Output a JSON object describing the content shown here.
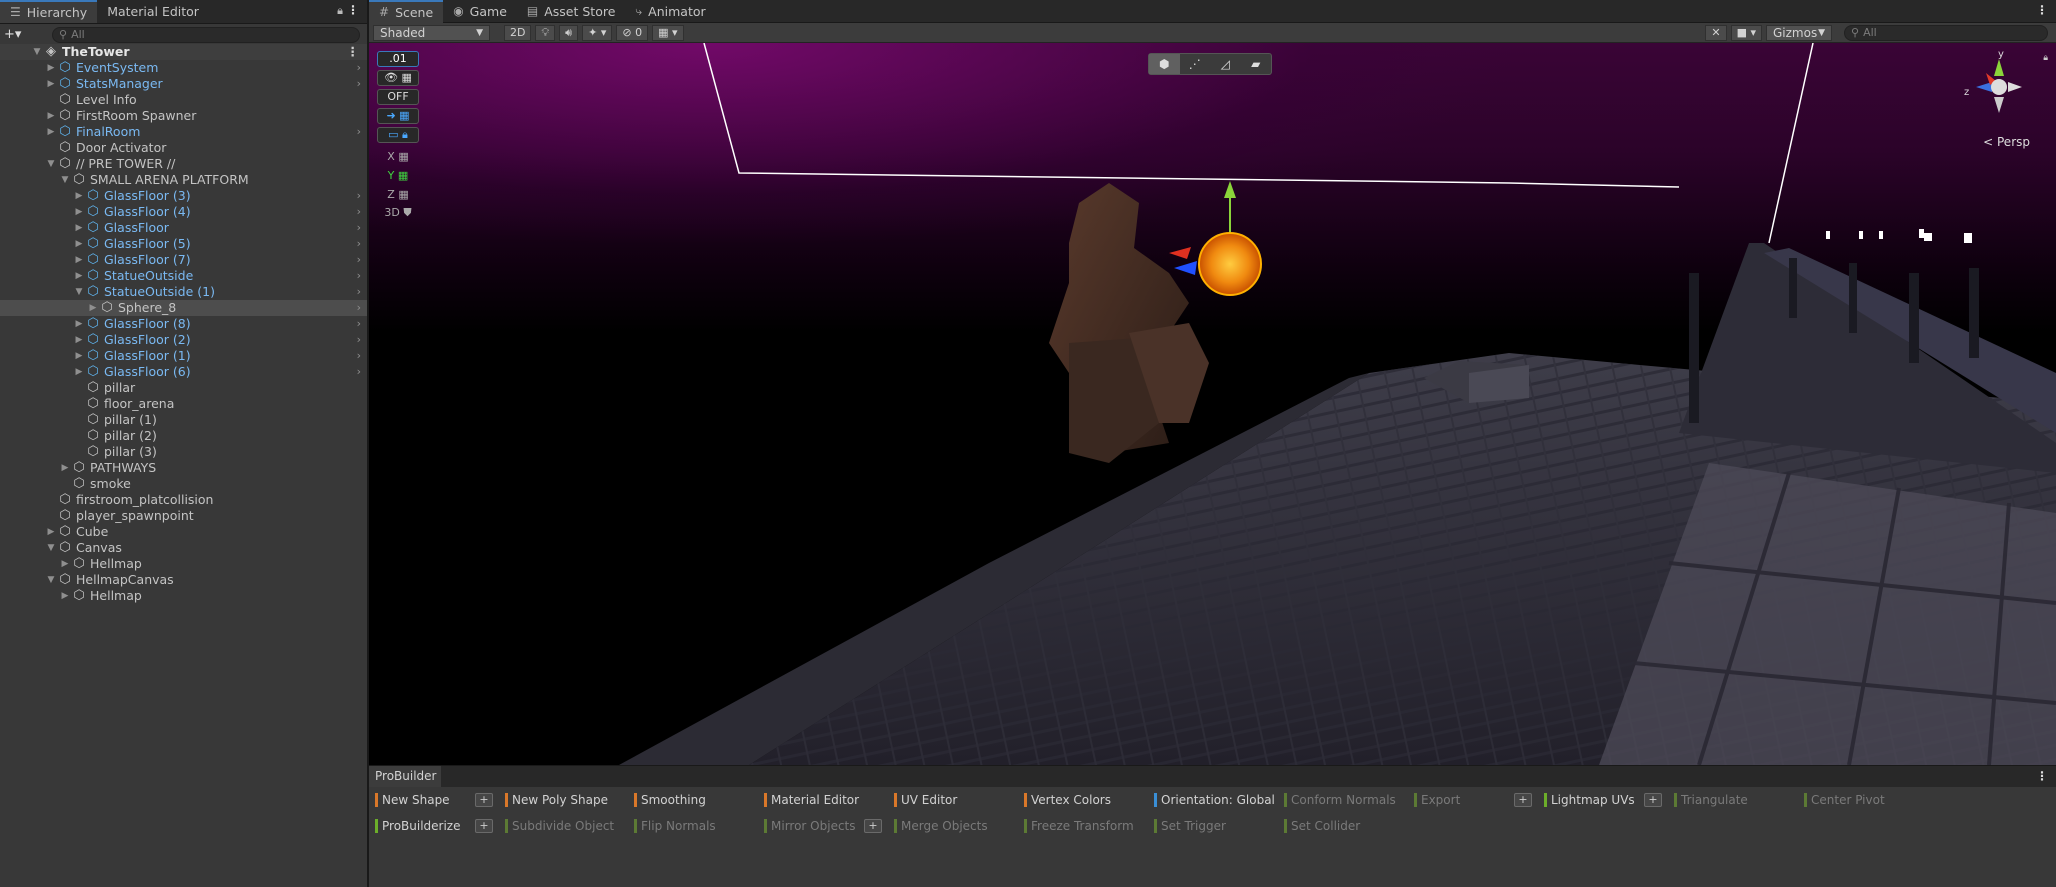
{
  "hierarchy": {
    "tab_hierarchy": "Hierarchy",
    "tab_material": "Material Editor",
    "add_label": "+▾",
    "search_placeholder": "All",
    "rows": [
      {
        "label": "TheTower",
        "depth": 0,
        "arrow": "▼",
        "icon": "scene",
        "kind": "root"
      },
      {
        "label": "EventSystem",
        "depth": 1,
        "arrow": "▶",
        "icon": "prefab",
        "kind": "prefab",
        "chev": true
      },
      {
        "label": "StatsManager",
        "depth": 1,
        "arrow": "▶",
        "icon": "prefab",
        "kind": "prefab",
        "chev": true
      },
      {
        "label": "Level Info",
        "depth": 1,
        "arrow": "",
        "icon": "object",
        "kind": "normal"
      },
      {
        "label": "FirstRoom Spawner",
        "depth": 1,
        "arrow": "▶",
        "icon": "object",
        "kind": "normal"
      },
      {
        "label": "FinalRoom",
        "depth": 1,
        "arrow": "▶",
        "icon": "prefab",
        "kind": "prefab",
        "chev": true
      },
      {
        "label": "Door Activator",
        "depth": 1,
        "arrow": "",
        "icon": "object",
        "kind": "normal"
      },
      {
        "label": "// PRE TOWER //",
        "depth": 1,
        "arrow": "▼",
        "icon": "object",
        "kind": "normal"
      },
      {
        "label": "SMALL ARENA PLATFORM",
        "depth": 2,
        "arrow": "▼",
        "icon": "object",
        "kind": "normal"
      },
      {
        "label": "GlassFloor (3)",
        "depth": 3,
        "arrow": "▶",
        "icon": "prefab",
        "kind": "prefab",
        "chev": true
      },
      {
        "label": "GlassFloor (4)",
        "depth": 3,
        "arrow": "▶",
        "icon": "prefab",
        "kind": "prefab",
        "chev": true
      },
      {
        "label": "GlassFloor",
        "depth": 3,
        "arrow": "▶",
        "icon": "prefab",
        "kind": "prefab",
        "chev": true
      },
      {
        "label": "GlassFloor (5)",
        "depth": 3,
        "arrow": "▶",
        "icon": "prefab",
        "kind": "prefab",
        "chev": true
      },
      {
        "label": "GlassFloor (7)",
        "depth": 3,
        "arrow": "▶",
        "icon": "prefab",
        "kind": "prefab",
        "chev": true
      },
      {
        "label": "StatueOutside",
        "depth": 3,
        "arrow": "▶",
        "icon": "prefab",
        "kind": "prefab",
        "chev": true
      },
      {
        "label": "StatueOutside (1)",
        "depth": 3,
        "arrow": "▼",
        "icon": "prefab",
        "kind": "prefab",
        "chev": true
      },
      {
        "label": "Sphere_8",
        "depth": 4,
        "arrow": "▶",
        "icon": "object",
        "kind": "selected",
        "chev": true
      },
      {
        "label": "GlassFloor (8)",
        "depth": 3,
        "arrow": "▶",
        "icon": "prefab",
        "kind": "prefab",
        "chev": true
      },
      {
        "label": "GlassFloor (2)",
        "depth": 3,
        "arrow": "▶",
        "icon": "prefab",
        "kind": "prefab",
        "chev": true
      },
      {
        "label": "GlassFloor (1)",
        "depth": 3,
        "arrow": "▶",
        "icon": "prefab",
        "kind": "prefab",
        "chev": true
      },
      {
        "label": "GlassFloor (6)",
        "depth": 3,
        "arrow": "▶",
        "icon": "prefab",
        "kind": "prefab",
        "chev": true
      },
      {
        "label": "pillar",
        "depth": 3,
        "arrow": "",
        "icon": "object",
        "kind": "normal"
      },
      {
        "label": "floor_arena",
        "depth": 3,
        "arrow": "",
        "icon": "object",
        "kind": "normal"
      },
      {
        "label": "pillar (1)",
        "depth": 3,
        "arrow": "",
        "icon": "object",
        "kind": "normal"
      },
      {
        "label": "pillar (2)",
        "depth": 3,
        "arrow": "",
        "icon": "object",
        "kind": "normal"
      },
      {
        "label": "pillar (3)",
        "depth": 3,
        "arrow": "",
        "icon": "object",
        "kind": "normal"
      },
      {
        "label": "PATHWAYS",
        "depth": 2,
        "arrow": "▶",
        "icon": "object",
        "kind": "normal"
      },
      {
        "label": "smoke",
        "depth": 2,
        "arrow": "",
        "icon": "object",
        "kind": "normal"
      },
      {
        "label": "firstroom_platcollision",
        "depth": 1,
        "arrow": "",
        "icon": "object",
        "kind": "normal"
      },
      {
        "label": "player_spawnpoint",
        "depth": 1,
        "arrow": "",
        "icon": "object",
        "kind": "normal"
      },
      {
        "label": "Cube",
        "depth": 1,
        "arrow": "▶",
        "icon": "object",
        "kind": "normal"
      },
      {
        "label": "Canvas",
        "depth": 1,
        "arrow": "▼",
        "icon": "object",
        "kind": "normal"
      },
      {
        "label": "Hellmap",
        "depth": 2,
        "arrow": "▶",
        "icon": "object",
        "kind": "normal"
      },
      {
        "label": "HellmapCanvas",
        "depth": 1,
        "arrow": "▼",
        "icon": "object",
        "kind": "normal"
      },
      {
        "label": "Hellmap",
        "depth": 2,
        "arrow": "▶",
        "icon": "object",
        "kind": "normal"
      }
    ]
  },
  "scene": {
    "tabs": [
      "Scene",
      "Game",
      "Asset Store",
      "Animator"
    ],
    "shading_mode": "Shaded",
    "btn_2d": "2D",
    "hidden_count": "0",
    "gizmos_label": "Gizmos",
    "search_placeholder": "All",
    "persp_label": "Persp",
    "axis_y": "y",
    "axis_z": "z",
    "snap_value": ".01",
    "grid_off": "OFF",
    "axis_labels": [
      "X",
      "Y",
      "Z"
    ],
    "label_3d": "3D"
  },
  "probuilder": {
    "title": "ProBuilder",
    "row1": [
      {
        "label": "New Shape",
        "color": "#d9782a",
        "dim": false,
        "plus": true
      },
      {
        "label": "New Poly Shape",
        "color": "#d9782a",
        "dim": false
      },
      {
        "label": "Smoothing",
        "color": "#d9782a",
        "dim": false
      },
      {
        "label": "Material Editor",
        "color": "#d9782a",
        "dim": false
      },
      {
        "label": "UV Editor",
        "color": "#d9782a",
        "dim": false
      },
      {
        "label": "Vertex Colors",
        "color": "#d9782a",
        "dim": false
      },
      {
        "label": "Orientation: Global",
        "color": "#3a8fd6",
        "dim": false
      },
      {
        "label": "Conform Normals",
        "color": "#5c7a34",
        "dim": true
      },
      {
        "label": "Export",
        "color": "#5c7a34",
        "dim": true,
        "plus": true
      },
      {
        "label": "Lightmap UVs",
        "color": "#6cae2a",
        "dim": false,
        "plus": true
      },
      {
        "label": "Triangulate",
        "color": "#5c7a34",
        "dim": true
      },
      {
        "label": "Center Pivot",
        "color": "#5c7a34",
        "dim": true
      }
    ],
    "row2": [
      {
        "label": "ProBuilderize",
        "color": "#6cae2a",
        "dim": false,
        "plus": true
      },
      {
        "label": "Subdivide Object",
        "color": "#5c7a34",
        "dim": true
      },
      {
        "label": "Flip Normals",
        "color": "#5c7a34",
        "dim": true
      },
      {
        "label": "Mirror Objects",
        "color": "#5c7a34",
        "dim": true,
        "plus": true
      },
      {
        "label": "Merge Objects",
        "color": "#5c7a34",
        "dim": true
      },
      {
        "label": "Freeze Transform",
        "color": "#5c7a34",
        "dim": true
      },
      {
        "label": "Set Trigger",
        "color": "#5c7a34",
        "dim": true
      },
      {
        "label": "Set Collider",
        "color": "#5c7a34",
        "dim": true
      }
    ]
  }
}
